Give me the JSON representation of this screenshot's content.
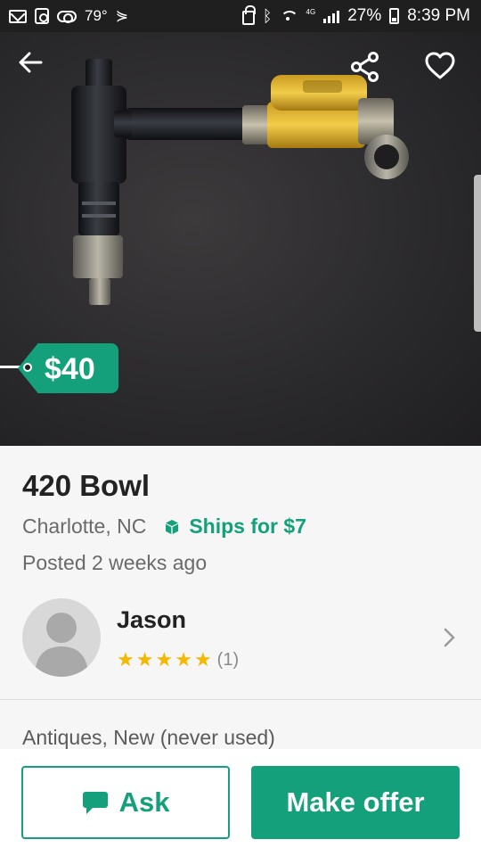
{
  "status_bar": {
    "temperature": "79°",
    "network": "4G",
    "battery": "27%",
    "time": "8:39 PM",
    "icons": [
      "mail-icon",
      "box-icon",
      "cloud-icon",
      "send-icon",
      "lock-icon",
      "bluetooth-icon",
      "wifi-icon",
      "signal-icon",
      "battery-icon"
    ]
  },
  "header": {
    "icons": [
      "back-arrow-icon",
      "share-icon",
      "heart-icon"
    ]
  },
  "listing": {
    "price": "$40",
    "title": "420 Bowl",
    "location": "Charlotte, NC",
    "shipping": "Ships for $7",
    "posted": "Posted 2 weeks ago",
    "category_condition": "Antiques, New (never used)"
  },
  "seller": {
    "name": "Jason",
    "rating_stars": 5,
    "rating_count": "(1)"
  },
  "actions": {
    "ask_label": "Ask",
    "offer_label": "Make offer"
  },
  "colors": {
    "accent": "#13a07a",
    "star": "#f5b800",
    "status_bar": "#1f1f1f"
  }
}
